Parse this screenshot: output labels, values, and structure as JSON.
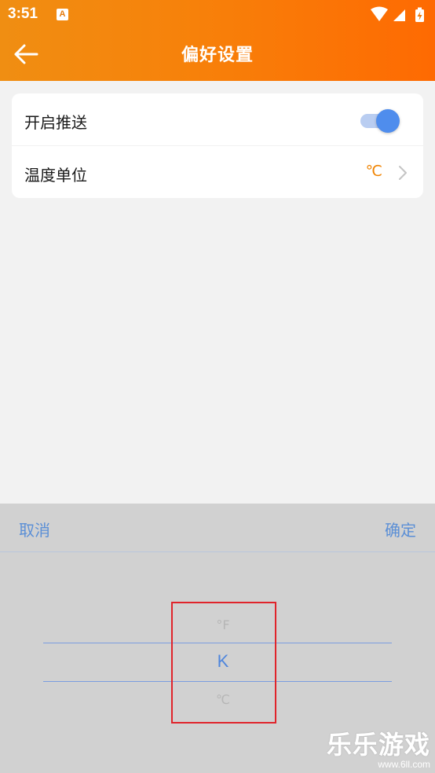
{
  "status_bar": {
    "time": "3:51",
    "notification_icon": "A",
    "icons": [
      "wifi-icon",
      "signal-icon",
      "battery-charging-icon"
    ]
  },
  "app_bar": {
    "title": "偏好设置",
    "back_icon": "arrow-left-icon"
  },
  "settings": {
    "push": {
      "label": "开启推送",
      "enabled": true
    },
    "temperature_unit": {
      "label": "温度单位",
      "value": "℃"
    }
  },
  "picker": {
    "cancel_label": "取消",
    "confirm_label": "确定",
    "options": [
      "°F",
      "K",
      "℃"
    ],
    "selected": "K"
  },
  "watermark": {
    "logo": "乐乐游戏",
    "url": "www.6ll.com"
  },
  "colors": {
    "header_start": "#f08e12",
    "header_end": "#fe6a02",
    "accent_blue": "#4f8ded",
    "unit_orange": "#f08300",
    "highlight_red": "#e0242b"
  }
}
